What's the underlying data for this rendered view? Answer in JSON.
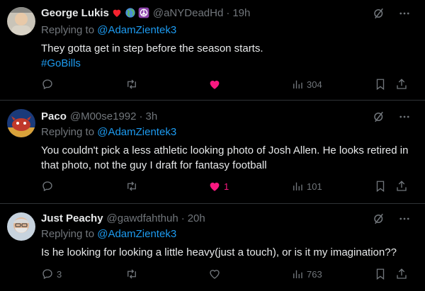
{
  "replies": [
    {
      "name": "George Lukis",
      "emoji": [
        "heart-emoji",
        "globe-emoji",
        "peace-emoji"
      ],
      "handle": "@aNYDeadHd",
      "sep": "·",
      "time": "19h",
      "replying_prefix": "Replying to ",
      "replying_to": "@AdamZientek3",
      "text": "They gotta get in step before the season starts.",
      "hashtag": "#GoBills",
      "reply_count": "",
      "retweet_count": "",
      "like_count": "",
      "liked": true,
      "views": "304"
    },
    {
      "name": "Paco",
      "handle": "@M00se1992",
      "sep": "·",
      "time": "3h",
      "replying_prefix": "Replying to ",
      "replying_to": "@AdamZientek3",
      "text": "You couldn't pick a less athletic looking photo of Josh Allen. He looks retired in that photo, not the guy I draft for fantasy football",
      "reply_count": "",
      "retweet_count": "",
      "like_count": "1",
      "liked": true,
      "views": "101"
    },
    {
      "name": "Just Peachy",
      "handle": "@gawdfahthuh",
      "sep": "·",
      "time": "20h",
      "replying_prefix": "Replying to ",
      "replying_to": "@AdamZientek3",
      "text": "Is he looking for looking a little heavy(just a touch), or is it my imagination??",
      "reply_count": "3",
      "retweet_count": "",
      "like_count": "",
      "liked": false,
      "views": "763"
    }
  ],
  "colors": {
    "background": "#000000",
    "text": "#e7e9ea",
    "muted": "#71767b",
    "link": "#1d9bf0",
    "like": "#f91880",
    "divider": "#2f3336"
  }
}
